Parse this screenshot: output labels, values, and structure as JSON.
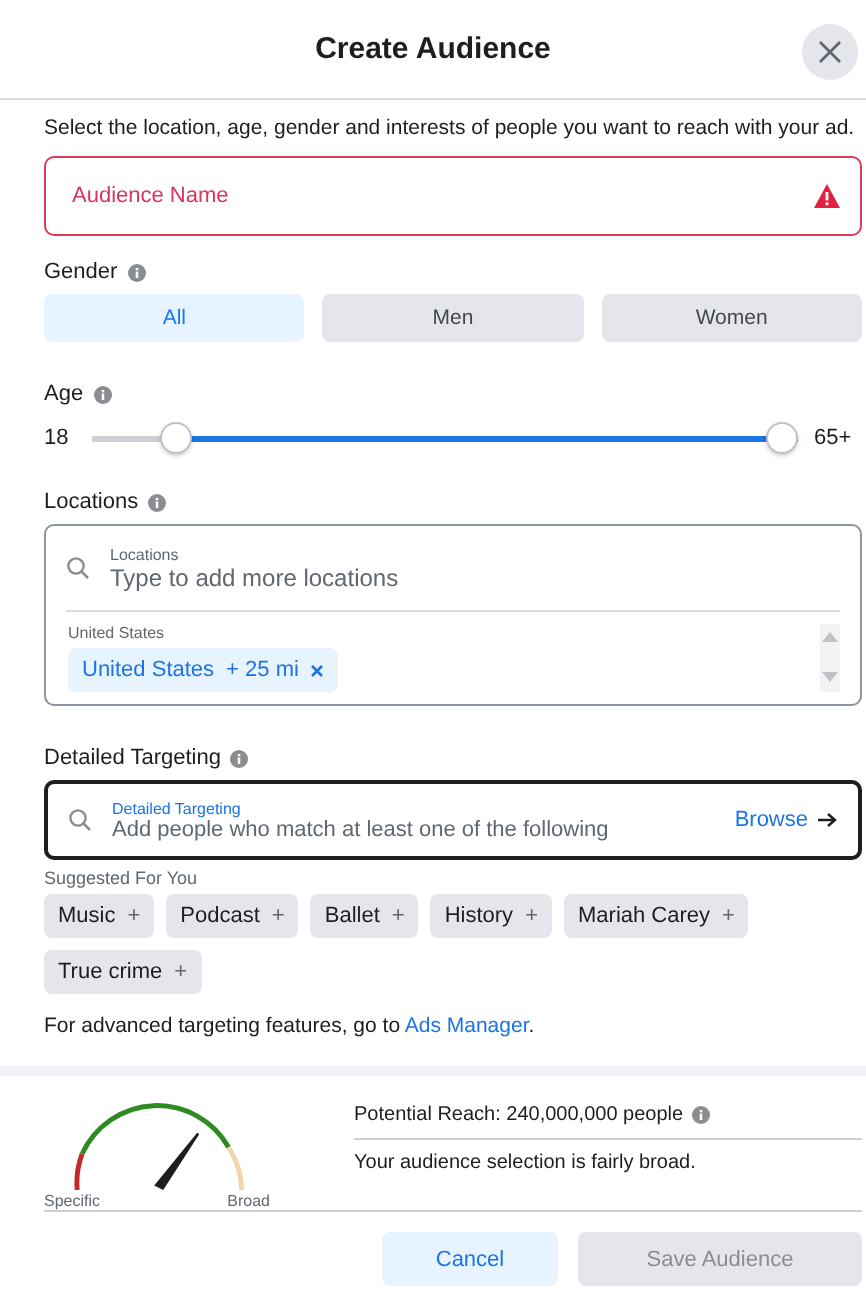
{
  "dialog": {
    "title": "Create Audience"
  },
  "intro": "Select the location, age, gender and interests of people you want to reach with your ad.",
  "audience_name": {
    "placeholder": "Audience Name",
    "error": true
  },
  "gender": {
    "label": "Gender",
    "options": [
      {
        "label": "All",
        "selected": true
      },
      {
        "label": "Men",
        "selected": false
      },
      {
        "label": "Women",
        "selected": false
      }
    ]
  },
  "age": {
    "label": "Age",
    "min_label": "18",
    "max_label": "65+"
  },
  "locations": {
    "label": "Locations",
    "field_label": "Locations",
    "placeholder": "Type to add more locations",
    "group": "United States",
    "tags": [
      {
        "name": "United States",
        "radius": "+ 25 mi"
      }
    ]
  },
  "detailed_targeting": {
    "label": "Detailed Targeting",
    "field_label": "Detailed Targeting",
    "placeholder": "Add people who match at least one of the following",
    "browse": "Browse",
    "focused": true
  },
  "suggested": {
    "label": "Suggested For You",
    "chips": [
      {
        "label": "Music",
        "add": "+"
      },
      {
        "label": "Podcast",
        "add": "+"
      },
      {
        "label": "Ballet",
        "add": "+"
      },
      {
        "label": "History",
        "add": "+"
      },
      {
        "label": "Mariah Carey",
        "add": "+"
      },
      {
        "label": "True crime",
        "add": "+"
      }
    ]
  },
  "advanced": {
    "text": "For advanced targeting features, go to",
    "link": "Ads Manager",
    "end": "."
  },
  "reach": {
    "gauge": {
      "left": "Specific",
      "right": "Broad"
    },
    "potential": "Potential Reach: 240,000,000 people",
    "note": "Your audience selection is fairly broad."
  },
  "buttons": [
    {
      "label": "Cancel",
      "kind": "secondary",
      "disabled": false
    },
    {
      "label": "Save Audience",
      "kind": "primary",
      "disabled": true
    }
  ]
}
